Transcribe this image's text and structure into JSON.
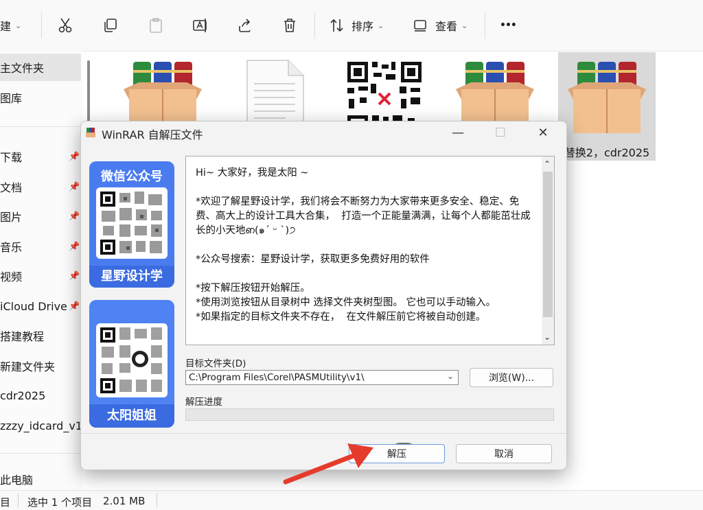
{
  "toolbar": {
    "new_label": "建",
    "sort_label": "排序",
    "view_label": "查看",
    "more_label": "•••"
  },
  "sidebar": {
    "items": [
      {
        "label": "主文件夹",
        "pinned": false
      },
      {
        "label": "图库",
        "pinned": false
      },
      {
        "label": "下载",
        "pinned": true
      },
      {
        "label": "文档",
        "pinned": true
      },
      {
        "label": "图片",
        "pinned": true
      },
      {
        "label": "音乐",
        "pinned": true
      },
      {
        "label": "视频",
        "pinned": true
      },
      {
        "label": "iCloud Drive",
        "pinned": true
      },
      {
        "label": "搭建教程",
        "pinned": false
      },
      {
        "label": "新建文件夹",
        "pinned": false
      },
      {
        "label": "cdr2025",
        "pinned": false
      },
      {
        "label": "zzzy_idcard_v1",
        "pinned": false
      },
      {
        "label": "此电脑",
        "pinned": false
      }
    ]
  },
  "files": [
    {
      "label": "",
      "type": "rar-archive"
    },
    {
      "label": "",
      "type": "text-document"
    },
    {
      "label": "",
      "type": "qr-image"
    },
    {
      "label": "",
      "type": "rar-archive"
    },
    {
      "label": "替换2，cdr2025",
      "type": "rar-archive"
    }
  ],
  "statusbar": {
    "count_label": "目",
    "selection_label": "选中 1 个项目",
    "size_label": "2.01 MB"
  },
  "dialog": {
    "title": "WinRAR 自解压文件",
    "promo_top": {
      "heading": "微信公众号",
      "footer": "星野设计学"
    },
    "promo_bottom": {
      "footer": "太阳姐姐"
    },
    "text_content": "Hi~ 大家好，我是太阳 ~\n\n*欢迎了解星野设计学，我们将会不断努力为大家带来更多安全、稳定、免费、高大上的设计工具大合集，  打造一个正能量满满，让每个人都能茁壮成长的小天地ഩ(๑´ ᵕ ˋ)੭\n\n*公众号搜索：星野设计学，获取更多免费好用的软件\n\n*按下解压按钮开始解压。\n*使用浏览按钮从目录树中 选择文件夹树型图。 它也可以手动输入。\n*如果指定的目标文件夹不存在，  在文件解压前它将被自动创建。",
    "dest_label": "目标文件夹(D)",
    "dest_value": "C:\\Program Files\\Corel\\PASMUtility\\v1\\",
    "browse_label": "浏览(W)...",
    "progress_label": "解压进度",
    "progress_value": 0,
    "extract_label": "解压",
    "cancel_label": "取消"
  },
  "colors": {
    "promo_blue": "#4a7cf0",
    "arrow_red": "#e53b2c"
  }
}
